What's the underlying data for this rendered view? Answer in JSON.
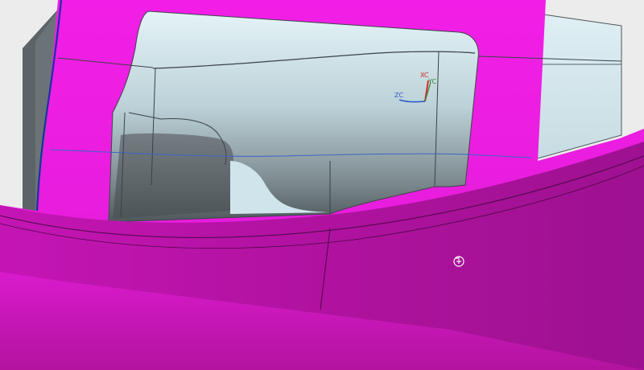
{
  "viewport": {
    "background_color": "#ececec",
    "part_color": "#ef1fe6",
    "part_shadow_color": "#a5129f",
    "steel_color": "#5f666b",
    "light_surface_color": "#d9eef3"
  },
  "triad": {
    "xc_label": "XC",
    "yc_label": "YC",
    "zc_label": "ZC",
    "xc_color": "#d42a2a",
    "yc_color": "#2c8a2c",
    "zc_color": "#2a54c8"
  },
  "cursor": {
    "icon": "rotate-cursor-icon"
  }
}
